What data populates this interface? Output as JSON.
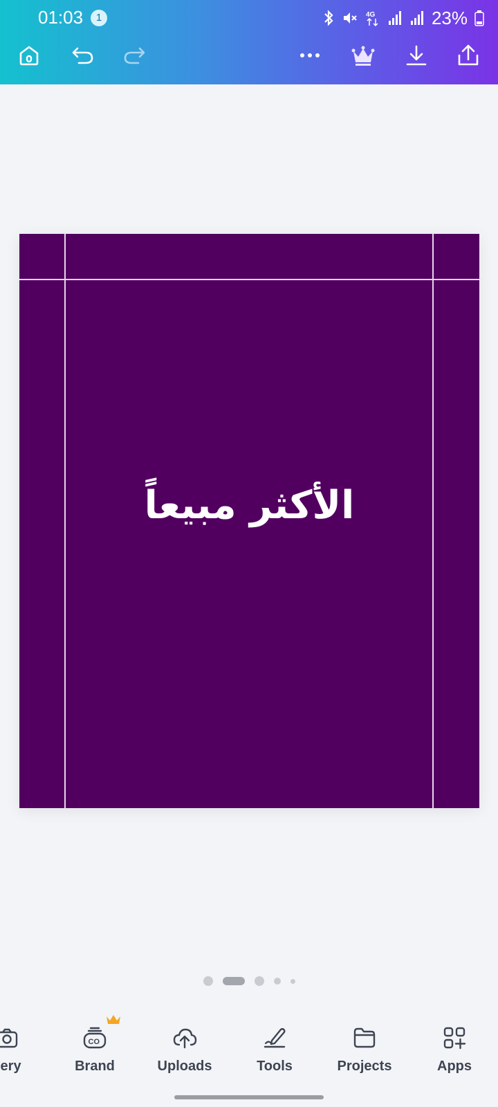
{
  "status_bar": {
    "time": "01:03",
    "notification_count": "1",
    "battery": "23%"
  },
  "toolbar": {
    "icons": [
      "home-icon",
      "undo-icon",
      "redo-icon",
      "more-icon",
      "crown-icon",
      "download-icon",
      "share-icon"
    ]
  },
  "canvas": {
    "background_color": "#520060",
    "text": "الأكثر مبيعاً"
  },
  "pagination": {
    "active_index": 1,
    "dot_count": 5
  },
  "bottom_nav": {
    "items": [
      {
        "label": "llery",
        "icon": "gallery-icon"
      },
      {
        "label": "Brand",
        "icon": "brand-icon"
      },
      {
        "label": "Uploads",
        "icon": "uploads-icon"
      },
      {
        "label": "Tools",
        "icon": "tools-icon"
      },
      {
        "label": "Projects",
        "icon": "projects-icon"
      },
      {
        "label": "Apps",
        "icon": "apps-icon"
      }
    ]
  },
  "colors": {
    "accent_gradient_start": "#14c1cf",
    "accent_gradient_end": "#7a33e6",
    "premium_crown": "#f5a623"
  }
}
